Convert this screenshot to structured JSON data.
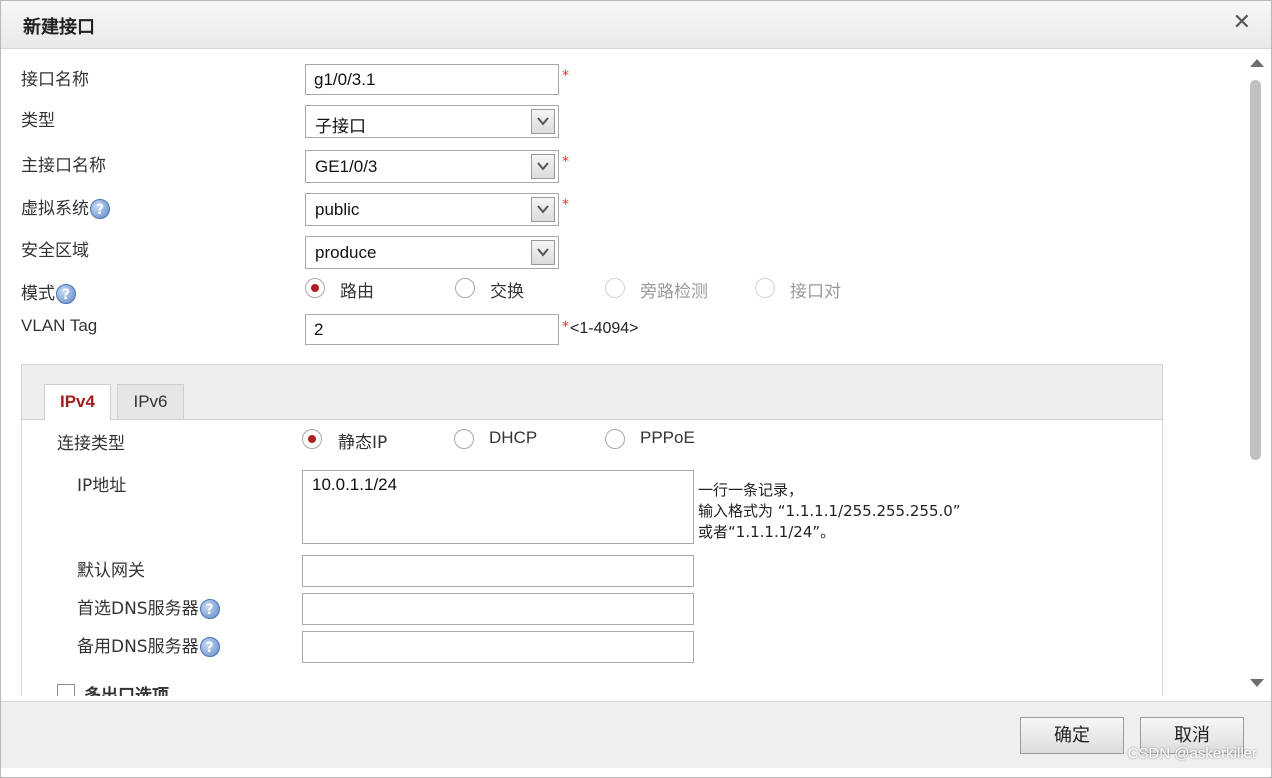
{
  "dialog": {
    "title": "新建接口",
    "close_label": "✕"
  },
  "form": {
    "interface_name": {
      "label": "接口名称",
      "value": "g1/0/3.1",
      "required": "*"
    },
    "type": {
      "label": "类型",
      "value": "子接口"
    },
    "parent_interface": {
      "label": "主接口名称",
      "value": "GE1/0/3",
      "required": "*"
    },
    "vsys": {
      "label": "虚拟系统",
      "value": "public",
      "required": "*"
    },
    "security_zone": {
      "label": "安全区域",
      "value": "produce"
    },
    "mode": {
      "label": "模式",
      "options": [
        {
          "label": "路由",
          "selected": true
        },
        {
          "label": "交换",
          "selected": false
        },
        {
          "label": "旁路检测",
          "selected": false
        },
        {
          "label": "接口对",
          "selected": false
        }
      ]
    },
    "vlan_tag": {
      "label": "VLAN Tag",
      "value": "2",
      "required": "*",
      "range_hint": "<1-4094>"
    }
  },
  "tabs": [
    {
      "label": "IPv4",
      "active": true
    },
    {
      "label": "IPv6",
      "active": false
    }
  ],
  "ipv4": {
    "connection_type": {
      "label": "连接类型",
      "options": [
        {
          "label": "静态IP",
          "selected": true
        },
        {
          "label": "DHCP",
          "selected": false
        },
        {
          "label": "PPPoE",
          "selected": false
        }
      ]
    },
    "ip_address": {
      "label": "IP地址",
      "value": "10.0.1.1/24",
      "hint_lines": [
        "一行一条记录，",
        "输入格式为 “1.1.1.1/255.255.255.0”",
        "或者“1.1.1.1/24”。"
      ]
    },
    "default_gateway": {
      "label": "默认网关",
      "value": ""
    },
    "primary_dns": {
      "label": "首选DNS服务器",
      "value": ""
    },
    "secondary_dns": {
      "label": "备用DNS服务器",
      "value": ""
    },
    "multi_egress": {
      "label": "多出口选项"
    }
  },
  "footer": {
    "confirm_label": "确定",
    "cancel_label": "取消"
  },
  "watermark": "CSDN @askerkiller",
  "colors": {
    "accent_red": "#a11e1e",
    "required_red": "#e03030",
    "help_blue": "#5f88c8"
  }
}
